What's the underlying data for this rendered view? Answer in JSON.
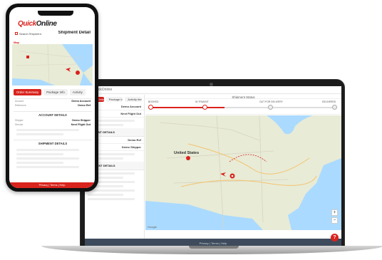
{
  "brand": {
    "name_prefix": "Quick",
    "name_suffix": "Online",
    "accent": "#d9231d"
  },
  "phone": {
    "search_label": "Search Shipment",
    "page_title": "Shipment Detail",
    "map_label": "Map",
    "tabs": [
      "Order Summary",
      "Package Info",
      "Activity"
    ],
    "account_heading": "ACCOUNT DETAILS",
    "shipment_heading": "SHIPMENT DETAILS",
    "fields": [
      {
        "k": "Account",
        "v": "Demo Account"
      },
      {
        "k": "Reference",
        "v": "Demo Ref"
      },
      {
        "k": "Shipper",
        "v": "Demo Shipper"
      },
      {
        "k": "Service",
        "v": "Next Flight Out"
      }
    ],
    "footer": "Privacy | Terms | Help"
  },
  "laptop": {
    "tabs": [
      "Order Details",
      "Package Info",
      "Activity Items"
    ],
    "status_title": "Shipment Status",
    "stages": [
      "Booked",
      "In Transit",
      "Out for Delivery",
      "Delivered"
    ],
    "left_heading_1": "ACCOUNT DETAILS",
    "left_heading_2": "SHIPMENT DETAILS",
    "left_rows": [
      {
        "k": "Account",
        "v": "Demo Account"
      },
      {
        "k": "Service",
        "v": "Next Flight Out"
      },
      {
        "k": "Reference",
        "v": "Demo Ref"
      },
      {
        "k": "Shipper",
        "v": "Demo Shipper"
      }
    ],
    "map_country": "United States",
    "map_footer": "Google",
    "zoom_in": "+",
    "zoom_out": "−",
    "help": "?",
    "footer": "Privacy | Terms | Help"
  }
}
